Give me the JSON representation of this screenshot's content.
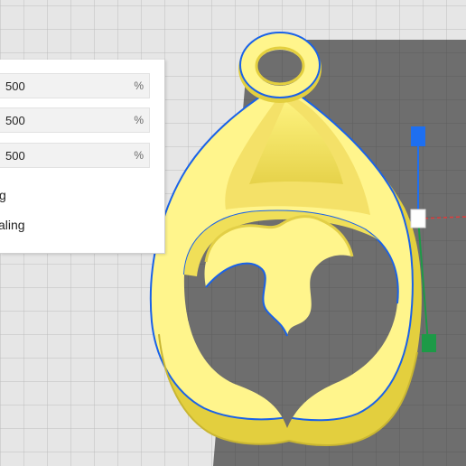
{
  "scale_panel": {
    "fields": [
      {
        "value": "500",
        "unit": "%"
      },
      {
        "value": "500",
        "unit": "%"
      },
      {
        "value": "500",
        "unit": "%"
      }
    ],
    "option_1_label": "g",
    "option_2_label": "aling"
  },
  "colors": {
    "model_yellow": "#fff58c",
    "model_shade": "#e3d040",
    "outline_blue": "#1a62e8",
    "build_plate": "#6d6d6d",
    "gizmo_blue": "#1e6ff0",
    "gizmo_red": "#e23b3b",
    "gizmo_green": "#1d9a47"
  },
  "icons": [
    "scale-handle-z-icon",
    "scale-handle-y-icon",
    "scale-handle-center-icon"
  ]
}
